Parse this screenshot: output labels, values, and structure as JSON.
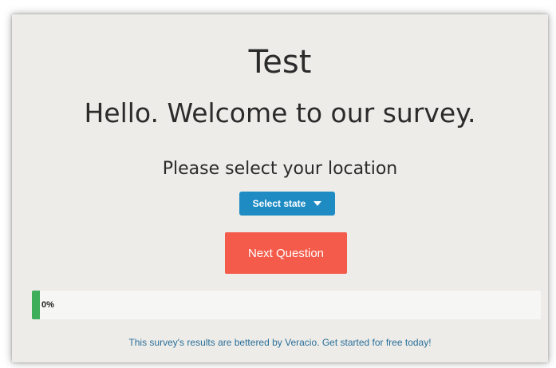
{
  "survey": {
    "title": "Test",
    "welcome": "Hello. Welcome to our survey.",
    "question": "Please select your location",
    "location_select": {
      "selected": "Select state",
      "icon": "caret-down-icon"
    },
    "next_button_label": "Next Question"
  },
  "progress": {
    "percent_label": "0%",
    "value": 0,
    "fill_color": "#3fae5b"
  },
  "footer": {
    "text": "This survey's results are bettered by Veracio. Get started for free today!"
  },
  "colors": {
    "select_bg": "#1e8bc3",
    "button_bg": "#f45b4a",
    "link": "#2a6f9a",
    "page_bg": "#edece8"
  }
}
